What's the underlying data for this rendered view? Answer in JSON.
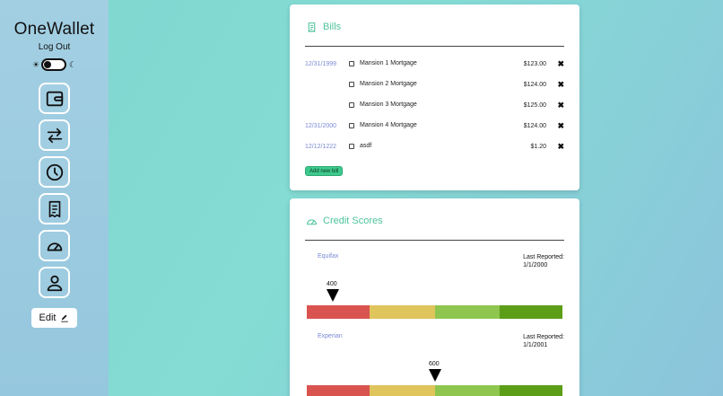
{
  "sidebar": {
    "app_title": "OneWallet",
    "logout_label": "Log Out",
    "theme_toggle": {
      "light_icon": "sun-icon",
      "dark_icon": "moon-icon",
      "selected": "light"
    },
    "nav_items": [
      {
        "name": "wallet",
        "icon": "wallet-icon"
      },
      {
        "name": "transfer",
        "icon": "transfer-arrows-icon"
      },
      {
        "name": "history",
        "icon": "clock-icon"
      },
      {
        "name": "bills",
        "icon": "receipt-icon"
      },
      {
        "name": "credit-score",
        "icon": "gauge-icon"
      },
      {
        "name": "profile",
        "icon": "user-icon"
      }
    ],
    "edit_label": "Edit"
  },
  "bills": {
    "title": "Bills",
    "title_icon": "receipt-icon",
    "items": [
      {
        "date": "12/31/1999",
        "name": "Mansion 1 Mortgage",
        "amount": "$123.00"
      },
      {
        "date": "",
        "name": "Mansion 2 Mortgage",
        "amount": "$124.00"
      },
      {
        "date": "",
        "name": "Mansion 3 Mortgage",
        "amount": "$125.00"
      },
      {
        "date": "12/31/2000",
        "name": "Mansion 4 Mortgage",
        "amount": "$124.00"
      },
      {
        "date": "12/12/1222",
        "name": "asdf",
        "amount": "$1.20"
      }
    ],
    "delete_symbol": "✖",
    "add_button_label": "Add new bill"
  },
  "credit_scores": {
    "title": "Credit Scores",
    "title_icon": "gauge-icon",
    "reported_prefix": "Last Reported:",
    "scale_colors": [
      "#d9534f",
      "#e0c45c",
      "#8fc64f",
      "#5c9e18"
    ],
    "bureaus": [
      {
        "name": "Equifax",
        "reported_date": "1/1/2000",
        "score": "400"
      },
      {
        "name": "Experian",
        "reported_date": "1/1/2001",
        "score": "600"
      }
    ]
  }
}
